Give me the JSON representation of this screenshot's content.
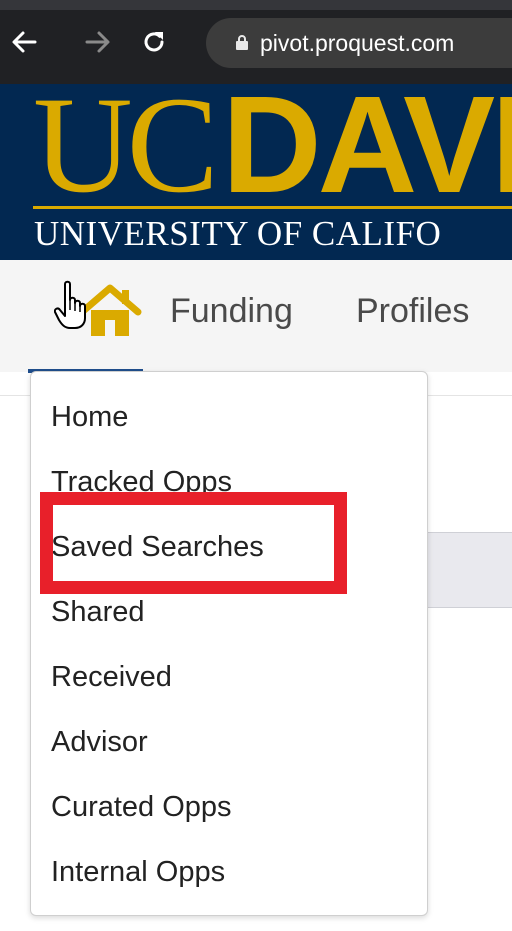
{
  "browser": {
    "url": "pivot.proquest.com",
    "icons": [
      "back-arrow-icon",
      "forward-arrow-icon",
      "reload-icon",
      "lock-icon"
    ]
  },
  "banner": {
    "logo_left": "UC",
    "logo_right": "DAVI",
    "subtitle": "UNIVERSITY OF CALIFO",
    "colors": {
      "navy": "#022851",
      "gold": "#daaa00"
    }
  },
  "nav": {
    "home_icon": "home-icon",
    "links": [
      "Funding",
      "Profiles"
    ]
  },
  "dropdown": {
    "items": [
      "Home",
      "Tracked Opps",
      "Saved Searches",
      "Shared",
      "Received",
      "Advisor",
      "Curated Opps",
      "Internal Opps"
    ],
    "highlighted_item": "Saved Searches",
    "highlight_color": "#e8202a"
  }
}
